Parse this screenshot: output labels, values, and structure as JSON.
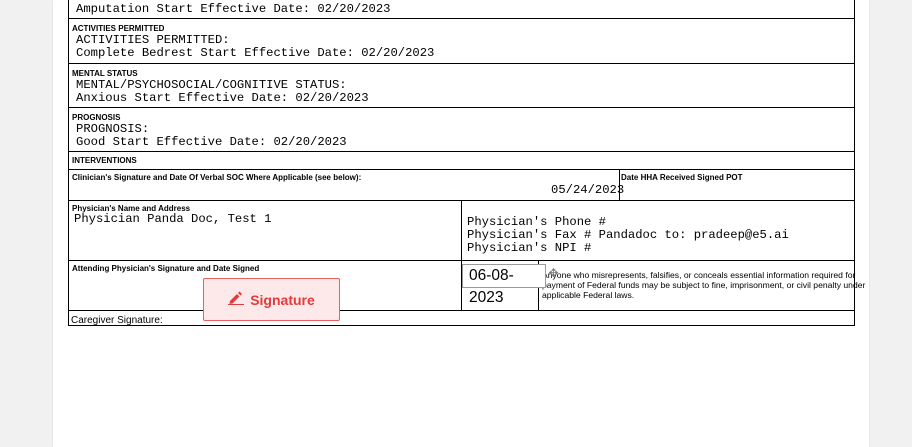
{
  "amputation": {
    "line": "Amputation Start Effective Date: 02/20/2023"
  },
  "activities": {
    "header": "ACTIVITIES PERMITTED",
    "line1": "ACTIVITIES PERMITTED:",
    "line2": "Complete Bedrest Start Effective Date: 02/20/2023"
  },
  "mental": {
    "header": "MENTAL STATUS",
    "line1": "MENTAL/PSYCHOSOCIAL/COGNITIVE STATUS:",
    "line2": "Anxious Start Effective Date: 02/20/2023"
  },
  "prognosis": {
    "header": "PROGNOSIS",
    "line1": "PROGNOSIS:",
    "line2": "Good Start Effective Date: 02/20/2023"
  },
  "interventions": {
    "header": "INTERVENTIONS"
  },
  "verbal_soc": {
    "header": "Clinician's Signature and Date Of Verbal SOC Where Applicable (see below):",
    "date": "05/24/2023",
    "hha_header": "Date HHA Received Signed POT"
  },
  "physician": {
    "header": "Physician's Name and Address",
    "name": "Physician Panda Doc, Test 1",
    "phone": "Physician's Phone #",
    "fax": "Physician's Fax # Pandadoc to: pradeep@e5.ai",
    "npi": "Physician's NPI #"
  },
  "attending": {
    "header": "Attending Physician's Signature and Date Signed",
    "signature_button": "Signature",
    "date_value": "06-08-2023",
    "legal_text_1": "Anyone who misrepresents, falsifies, or conceals essential information required for",
    "legal_text_2": "payment of Federal funds may be subject to fine, imprisonment, or civil penalty under",
    "legal_text_3": "applicable Federal laws."
  },
  "caregiver": {
    "label": "Caregiver Signature:"
  },
  "colors": {
    "signature_accent": "#e33b3b",
    "signature_bg": "#fde9e9",
    "border": "#000000"
  },
  "icons": {
    "signature": "pen-icon",
    "drag": "move-icon"
  }
}
